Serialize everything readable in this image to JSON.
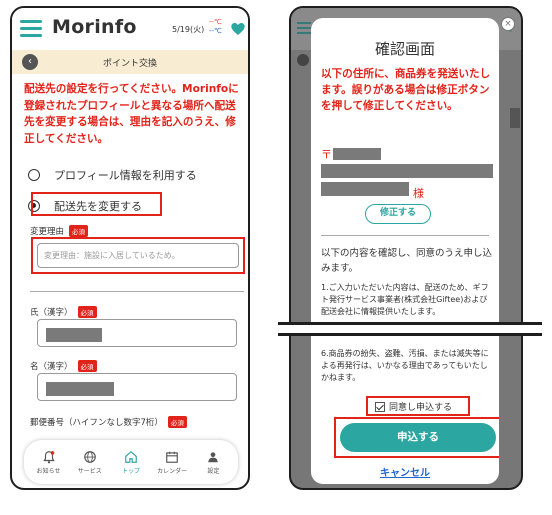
{
  "left": {
    "app_title": "Morinfo",
    "date": "5/19(火)",
    "temp_high": "--℃",
    "temp_low": "--℃",
    "sub_title": "ポイント交換",
    "notice": "配送先の設定を行ってください。Morinfoに登録されたプロフィールと異なる場所へ配送先を変更する場合は、理由を記入のうえ、修正してください。",
    "option_profile": "プロフィール情報を利用する",
    "option_change": "配送先を変更する",
    "reason_label": "変更理由",
    "required": "必須",
    "reason_placeholder": "変更理由：施設に入居しているため。",
    "name_kanji_label": "氏（漢字）",
    "name_given_label": "名（漢字）",
    "postal_label": "郵便番号（ハイフンなし数字7桁）",
    "nav": [
      {
        "label": "お知らせ",
        "icon": "bell-icon"
      },
      {
        "label": "サービス",
        "icon": "globe-icon"
      },
      {
        "label": "トップ",
        "icon": "home-icon"
      },
      {
        "label": "カレンダー",
        "icon": "calendar-icon"
      },
      {
        "label": "設定",
        "icon": "person-icon"
      }
    ]
  },
  "right": {
    "modal_title": "確認画面",
    "modal_notice": "以下の住所に、商品券を発送いたします。誤りがある場合は修正ボタンを押して修正してください。",
    "postal_mark": "〒",
    "sama": "様",
    "fix_button": "修正する",
    "confirm_text": "以下の内容を確認し、同意のうえ申し込みます。",
    "term_1": "1.ご入力いただいた内容は、配送のため、ギフト発行サービス事業者(株式会社Giftee)および配送会社に情報提供いたします。",
    "term_6": "6.商品券の紛失、盗難、汚損、または滅失等による再発行は、いかなる理由であってもいたしかねます。",
    "agree_label": "同意し申込する",
    "apply_button": "申込する",
    "cancel_link": "キャンセル"
  },
  "colors": {
    "accent": "#2ba6a0",
    "alert": "#e2231a",
    "link": "#1e66d0",
    "sub_bar": "#f8edd2"
  }
}
